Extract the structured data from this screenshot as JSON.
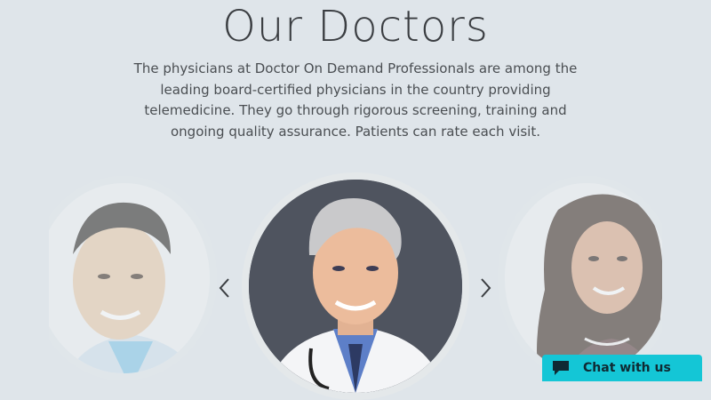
{
  "section": {
    "title": "Our Doctors",
    "description": "The physicians at Doctor On Demand Professionals are among the leading board-certified physicians in the country providing telemedicine. They go through rigorous screening, training and ongoing quality assurance. Patients can rate each visit."
  },
  "carousel": {
    "doctors": [
      {
        "name": "doctor-photo-left",
        "position": "left"
      },
      {
        "name": "doctor-photo-center",
        "position": "center"
      },
      {
        "name": "doctor-photo-right",
        "position": "right"
      }
    ],
    "prev_icon": "chevron-left-icon",
    "next_icon": "chevron-right-icon"
  },
  "chat": {
    "label": "Chat with us",
    "icon": "chat-bubble-icon",
    "color": "#14c6d6"
  },
  "colors": {
    "background": "#dfe5ea",
    "text": "#3f4347"
  }
}
